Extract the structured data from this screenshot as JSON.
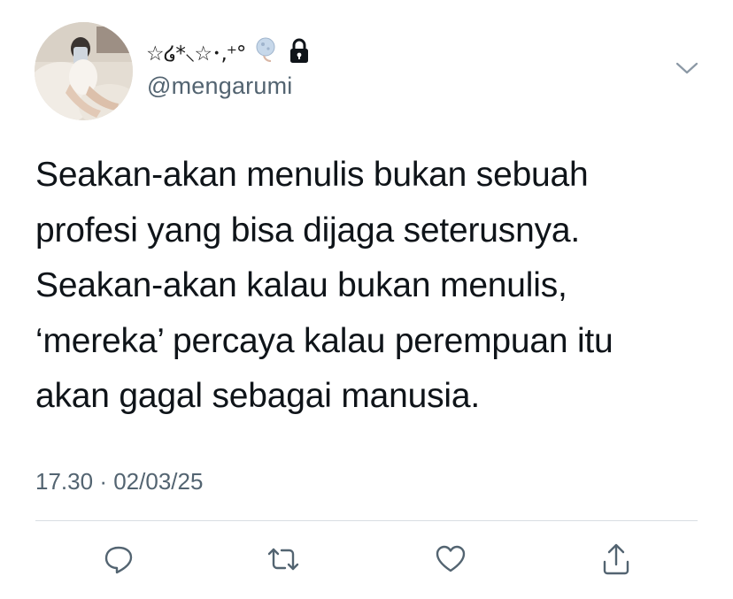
{
  "user": {
    "display_name": "☆໒*⸜☆･,⁺°",
    "handle": "@mengarumi",
    "protected": true
  },
  "tweet": {
    "lines": [
      "Seakan-akan menulis bukan sebuah",
      "profesi yang bisa dijaga seterusnya.",
      "Seakan-akan kalau bukan menulis,",
      "‘mereka’ percaya kalau perempuan itu",
      "akan gagal sebagai manusia."
    ],
    "time": "17.30",
    "separator": "·",
    "date": "02/03/25"
  },
  "actions": [
    {
      "name": "reply",
      "icon": "reply-icon"
    },
    {
      "name": "retweet",
      "icon": "retweet-icon"
    },
    {
      "name": "like",
      "icon": "heart-icon"
    },
    {
      "name": "share",
      "icon": "share-icon"
    }
  ],
  "colors": {
    "text": "#0f1419",
    "secondary": "#536471",
    "divider": "#d9dee2",
    "icon": "#536471"
  }
}
